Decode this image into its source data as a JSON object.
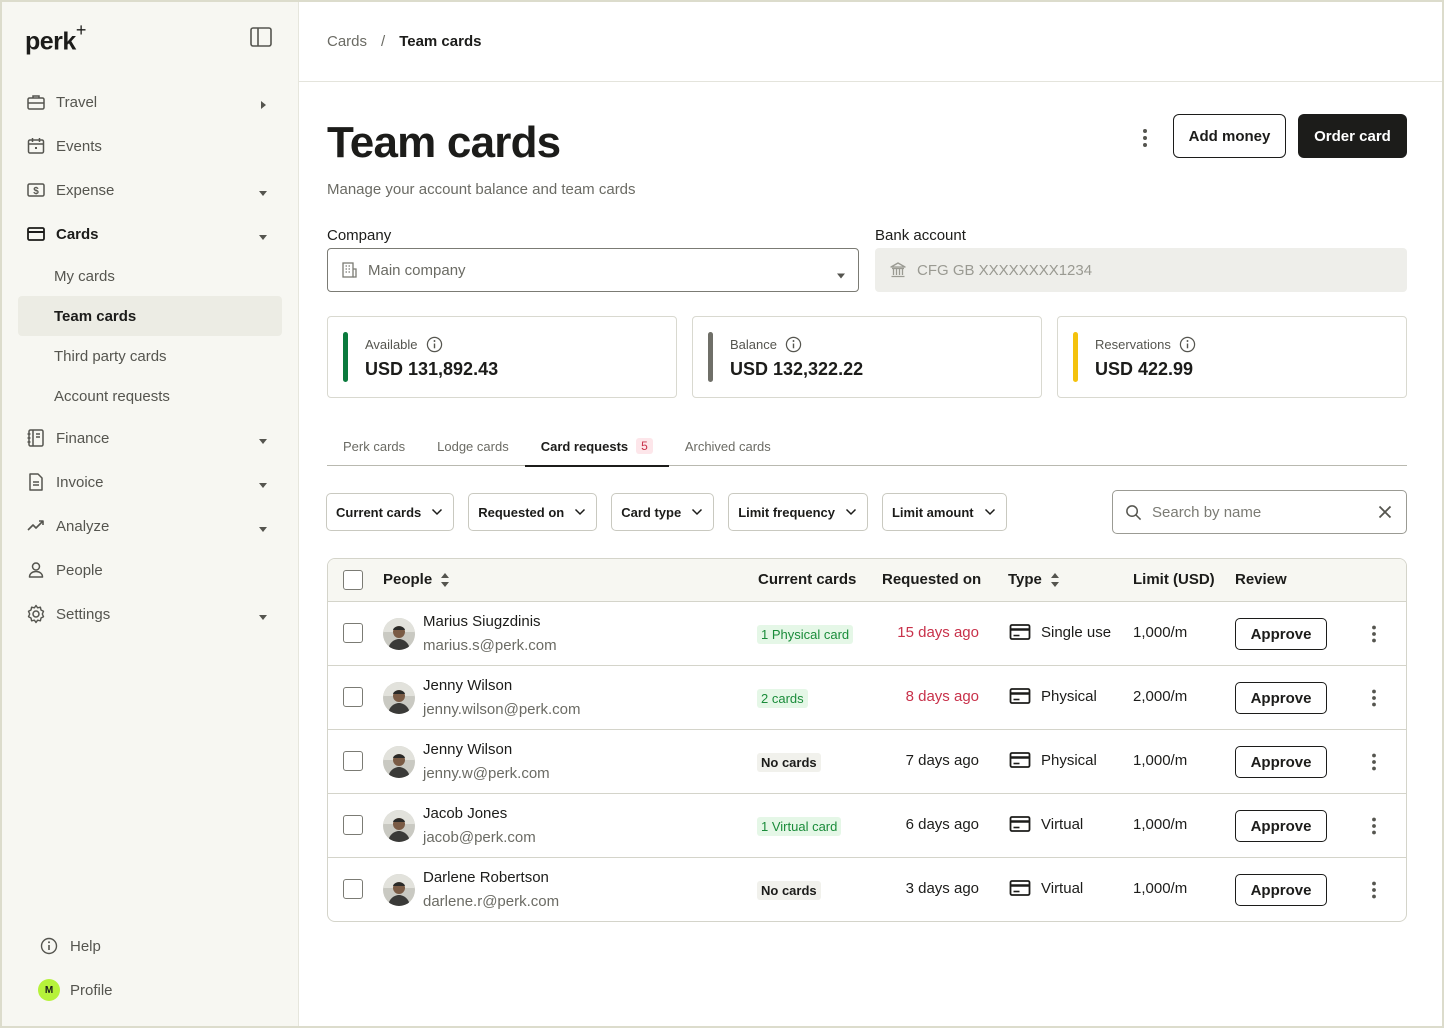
{
  "app": {
    "logo": "perk",
    "logo_mark": "+"
  },
  "sidebar": {
    "items": [
      {
        "label": "Travel",
        "icon": "briefcase-icon",
        "caret": "right"
      },
      {
        "label": "Events",
        "icon": "calendar-icon",
        "caret": ""
      },
      {
        "label": "Expense",
        "icon": "dollar-icon",
        "caret": "down"
      },
      {
        "label": "Cards",
        "icon": "card-icon",
        "caret": "down",
        "active": true
      },
      {
        "label": "Finance",
        "icon": "ledger-icon",
        "caret": "down"
      },
      {
        "label": "Invoice",
        "icon": "document-icon",
        "caret": "down"
      },
      {
        "label": "Analyze",
        "icon": "trend-icon",
        "caret": "down"
      },
      {
        "label": "People",
        "icon": "person-icon",
        "caret": ""
      },
      {
        "label": "Settings",
        "icon": "gear-icon",
        "caret": "down"
      }
    ],
    "card_subitems": [
      "My cards",
      "Team cards",
      "Third party cards",
      "Account requests"
    ],
    "active_subitem": "Team cards",
    "help": "Help",
    "profile": "Profile",
    "profile_initial": "M"
  },
  "breadcrumb": {
    "root": "Cards",
    "separator": "/",
    "current": "Team cards"
  },
  "header": {
    "title": "Team cards",
    "subtitle": "Manage your account balance and team cards",
    "add_money": "Add money",
    "order_card": "Order card"
  },
  "company": {
    "label": "Company",
    "value": "Main company"
  },
  "bank": {
    "label": "Bank account",
    "value": "CFG GB XXXXXXXX1234"
  },
  "stats": [
    {
      "label": "Available",
      "value": "USD 131,892.43",
      "color": "#0a7a3d"
    },
    {
      "label": "Balance",
      "value": "USD 132,322.22",
      "color": "#6f6f68"
    },
    {
      "label": "Reservations",
      "value": "USD 422.99",
      "color": "#f4c20d"
    }
  ],
  "tabs": [
    {
      "label": "Perk cards"
    },
    {
      "label": "Lodge cards"
    },
    {
      "label": "Card requests",
      "count": "5",
      "active": true
    },
    {
      "label": "Archived cards"
    }
  ],
  "filters": [
    "Current cards",
    "Requested on",
    "Card type",
    "Limit frequency",
    "Limit amount"
  ],
  "search": {
    "placeholder": "Search by name"
  },
  "table": {
    "headers": {
      "people": "People",
      "current_cards": "Current cards",
      "requested_on": "Requested on",
      "type": "Type",
      "limit": "Limit (USD)",
      "review": "Review"
    },
    "approve_label": "Approve",
    "rows": [
      {
        "name": "Marius Siugzdinis",
        "email": "marius.s@perk.com",
        "cards": "1 Physical card",
        "cards_style": "green",
        "requested": "15 days ago",
        "overdue": true,
        "type": "Single use",
        "limit": "1,000/m"
      },
      {
        "name": "Jenny Wilson",
        "email": "jenny.wilson@perk.com",
        "cards": "2 cards",
        "cards_style": "green",
        "requested": "8 days ago",
        "overdue": true,
        "type": "Physical",
        "limit": "2,000/m"
      },
      {
        "name": "Jenny Wilson",
        "email": "jenny.w@perk.com",
        "cards": "No cards",
        "cards_style": "grey",
        "requested": "7 days ago",
        "overdue": false,
        "type": "Physical",
        "limit": "1,000/m"
      },
      {
        "name": "Jacob Jones",
        "email": "jacob@perk.com",
        "cards": "1 Virtual card",
        "cards_style": "green",
        "requested": "6 days ago",
        "overdue": false,
        "type": "Virtual",
        "limit": "1,000/m"
      },
      {
        "name": "Darlene Robertson",
        "email": "darlene.r@perk.com",
        "cards": "No cards",
        "cards_style": "grey",
        "requested": "3 days ago",
        "overdue": false,
        "type": "Virtual",
        "limit": "1,000/m"
      }
    ]
  }
}
